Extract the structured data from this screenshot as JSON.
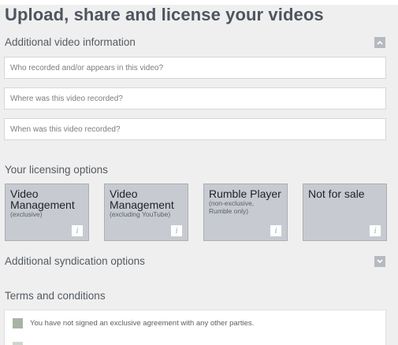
{
  "header": {
    "title": "Upload, share and license your videos"
  },
  "additional_info": {
    "title": "Additional video information",
    "toggle_icon": "chevron-up-icon",
    "fields": [
      {
        "placeholder": "Who recorded and/or appears in this video?",
        "value": ""
      },
      {
        "placeholder": "Where was this video recorded?",
        "value": ""
      },
      {
        "placeholder": "When was this video recorded?",
        "value": ""
      }
    ]
  },
  "licensing": {
    "title": "Your licensing options",
    "options": [
      {
        "title": "Video Management",
        "subtitle": "(exclusive)",
        "info_icon": "i"
      },
      {
        "title": "Video Management",
        "subtitle": "(excluding YouTube)",
        "info_icon": "i"
      },
      {
        "title": "Rumble Player",
        "subtitle": "(non-exclusive, Rumble only)",
        "info_icon": "i"
      },
      {
        "title": "Not for sale",
        "subtitle": "",
        "info_icon": "i"
      }
    ]
  },
  "syndication": {
    "title": "Additional syndication options",
    "toggle_icon": "chevron-down-icon"
  },
  "terms": {
    "title": "Terms and conditions",
    "items": [
      {
        "text": "You have not signed an exclusive agreement with any other parties."
      },
      {
        "text": ""
      }
    ]
  },
  "colors": {
    "card_background": "#c7cbd1",
    "checkbox": "#a8b3a4",
    "title_text": "#4e5560"
  }
}
